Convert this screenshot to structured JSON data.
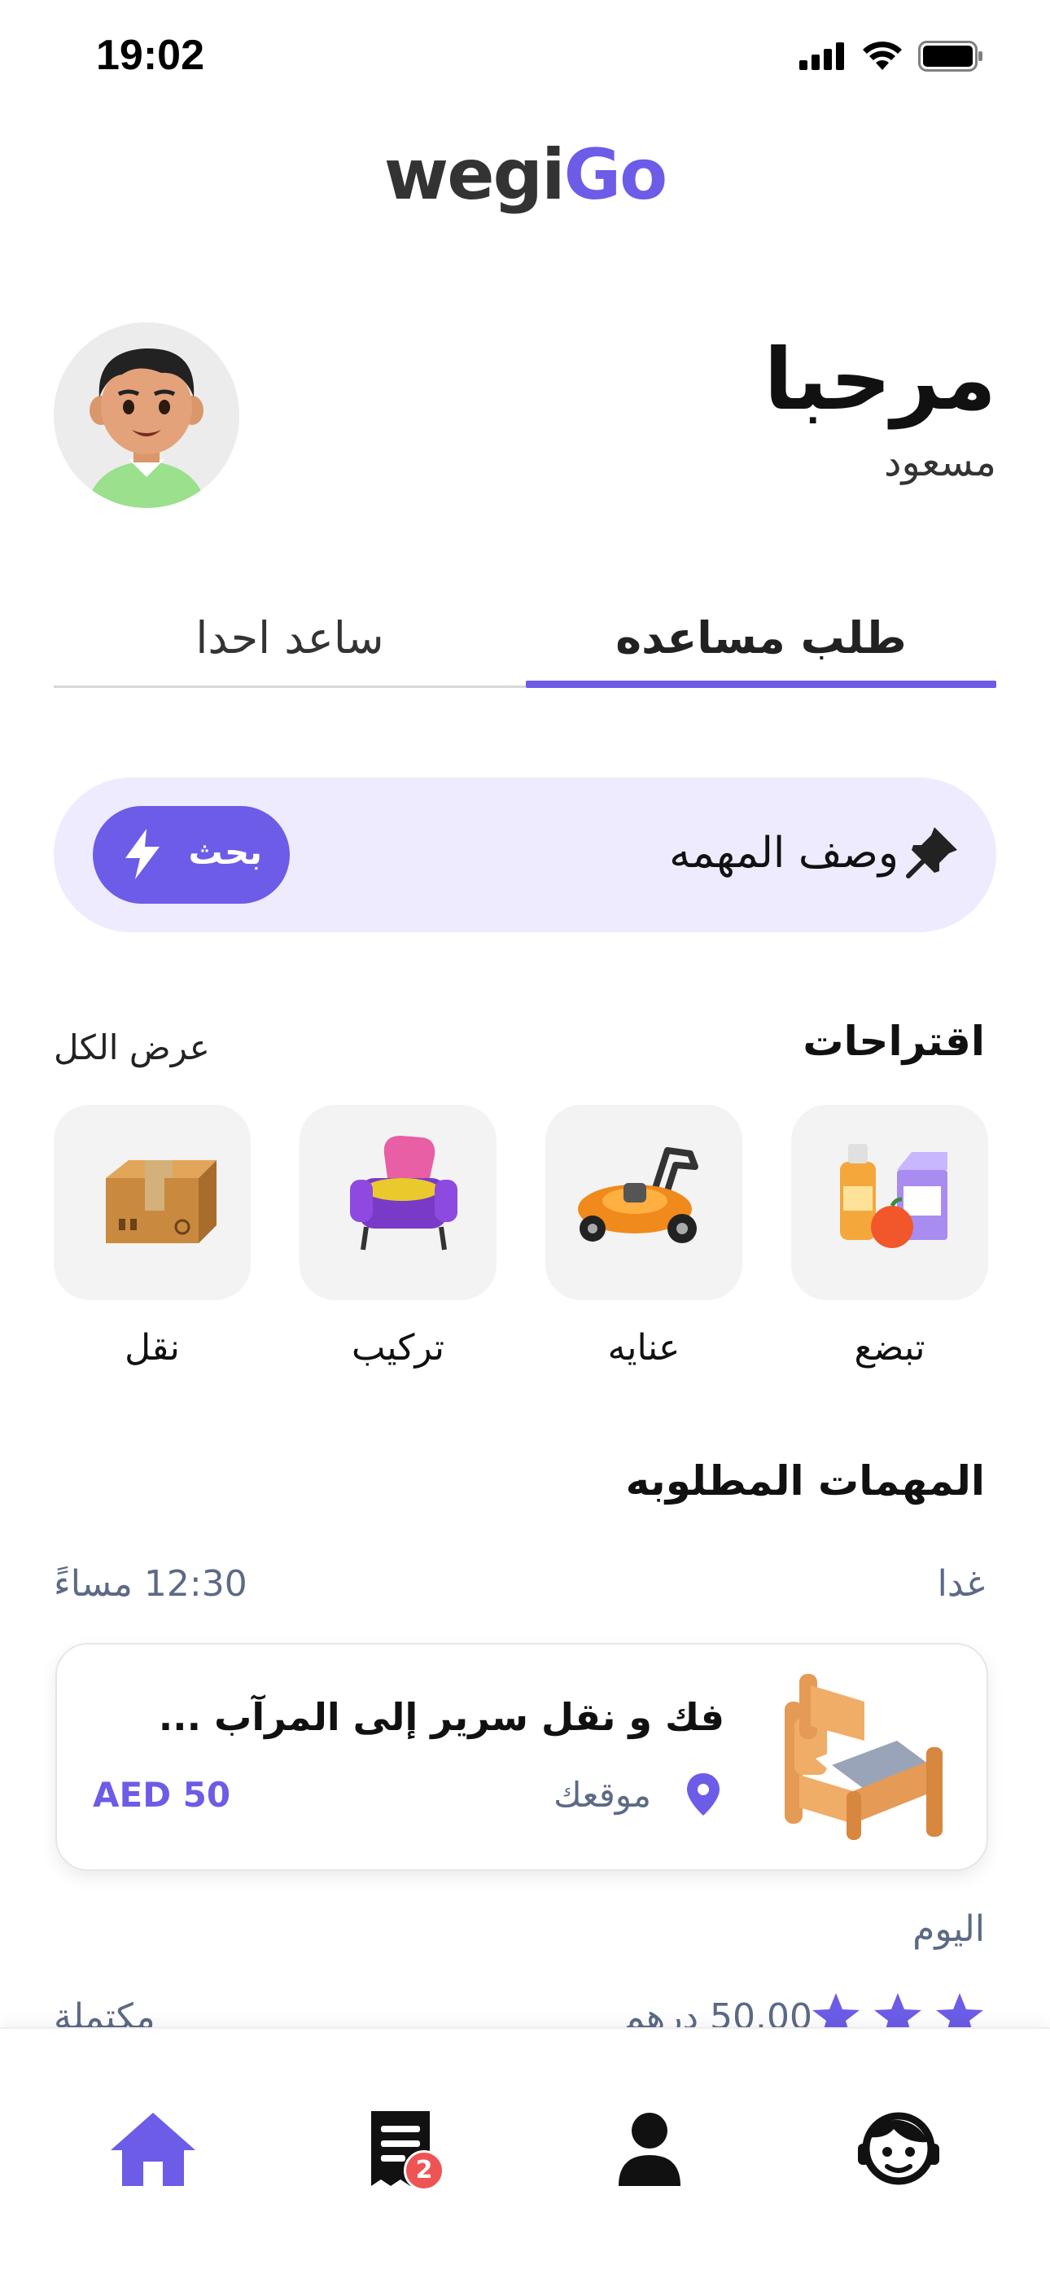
{
  "status_bar": {
    "time": "19:02"
  },
  "logo": {
    "part1": "wegi",
    "part2": "Go"
  },
  "greeting": {
    "title": "مرحبا",
    "name": "مسعود"
  },
  "tabs": [
    {
      "label": "طلب مساعده",
      "active": true
    },
    {
      "label": "ساعد احدا",
      "active": false
    }
  ],
  "search": {
    "placeholder": "وصف المهمه",
    "button_label": "بحث"
  },
  "suggestions": {
    "title": "اقتراحات",
    "view_all": "عرض الكل",
    "items": [
      {
        "label": "تبضع",
        "icon": "groceries-icon"
      },
      {
        "label": "عنايه",
        "icon": "lawn-mower-icon"
      },
      {
        "label": "تركيب",
        "icon": "armchair-icon"
      },
      {
        "label": "نقل",
        "icon": "box-icon"
      }
    ]
  },
  "tasks": {
    "title": "المهمات المطلوبه",
    "groups": [
      {
        "day": "غدا",
        "time": "12:30 مساءً",
        "task": {
          "title": "فك و نقل سرير إلى المرآب ...",
          "location": "موقعك",
          "price": "AED 50",
          "icon": "bed-icon"
        }
      },
      {
        "day": "اليوم",
        "rating": 3,
        "price": "50.00 درهم",
        "status": "مكتملة"
      }
    ]
  },
  "bottom_nav": {
    "items": [
      {
        "name": "home",
        "icon": "home-icon",
        "active": true
      },
      {
        "name": "tasks",
        "icon": "receipt-icon",
        "badge": "2"
      },
      {
        "name": "profile",
        "icon": "person-icon"
      },
      {
        "name": "support",
        "icon": "support-agent-icon"
      }
    ]
  },
  "colors": {
    "accent": "#6c5ce7",
    "accent_light": "#eeebff",
    "muted_text": "#5c6a86",
    "badge": "#ef5454"
  }
}
